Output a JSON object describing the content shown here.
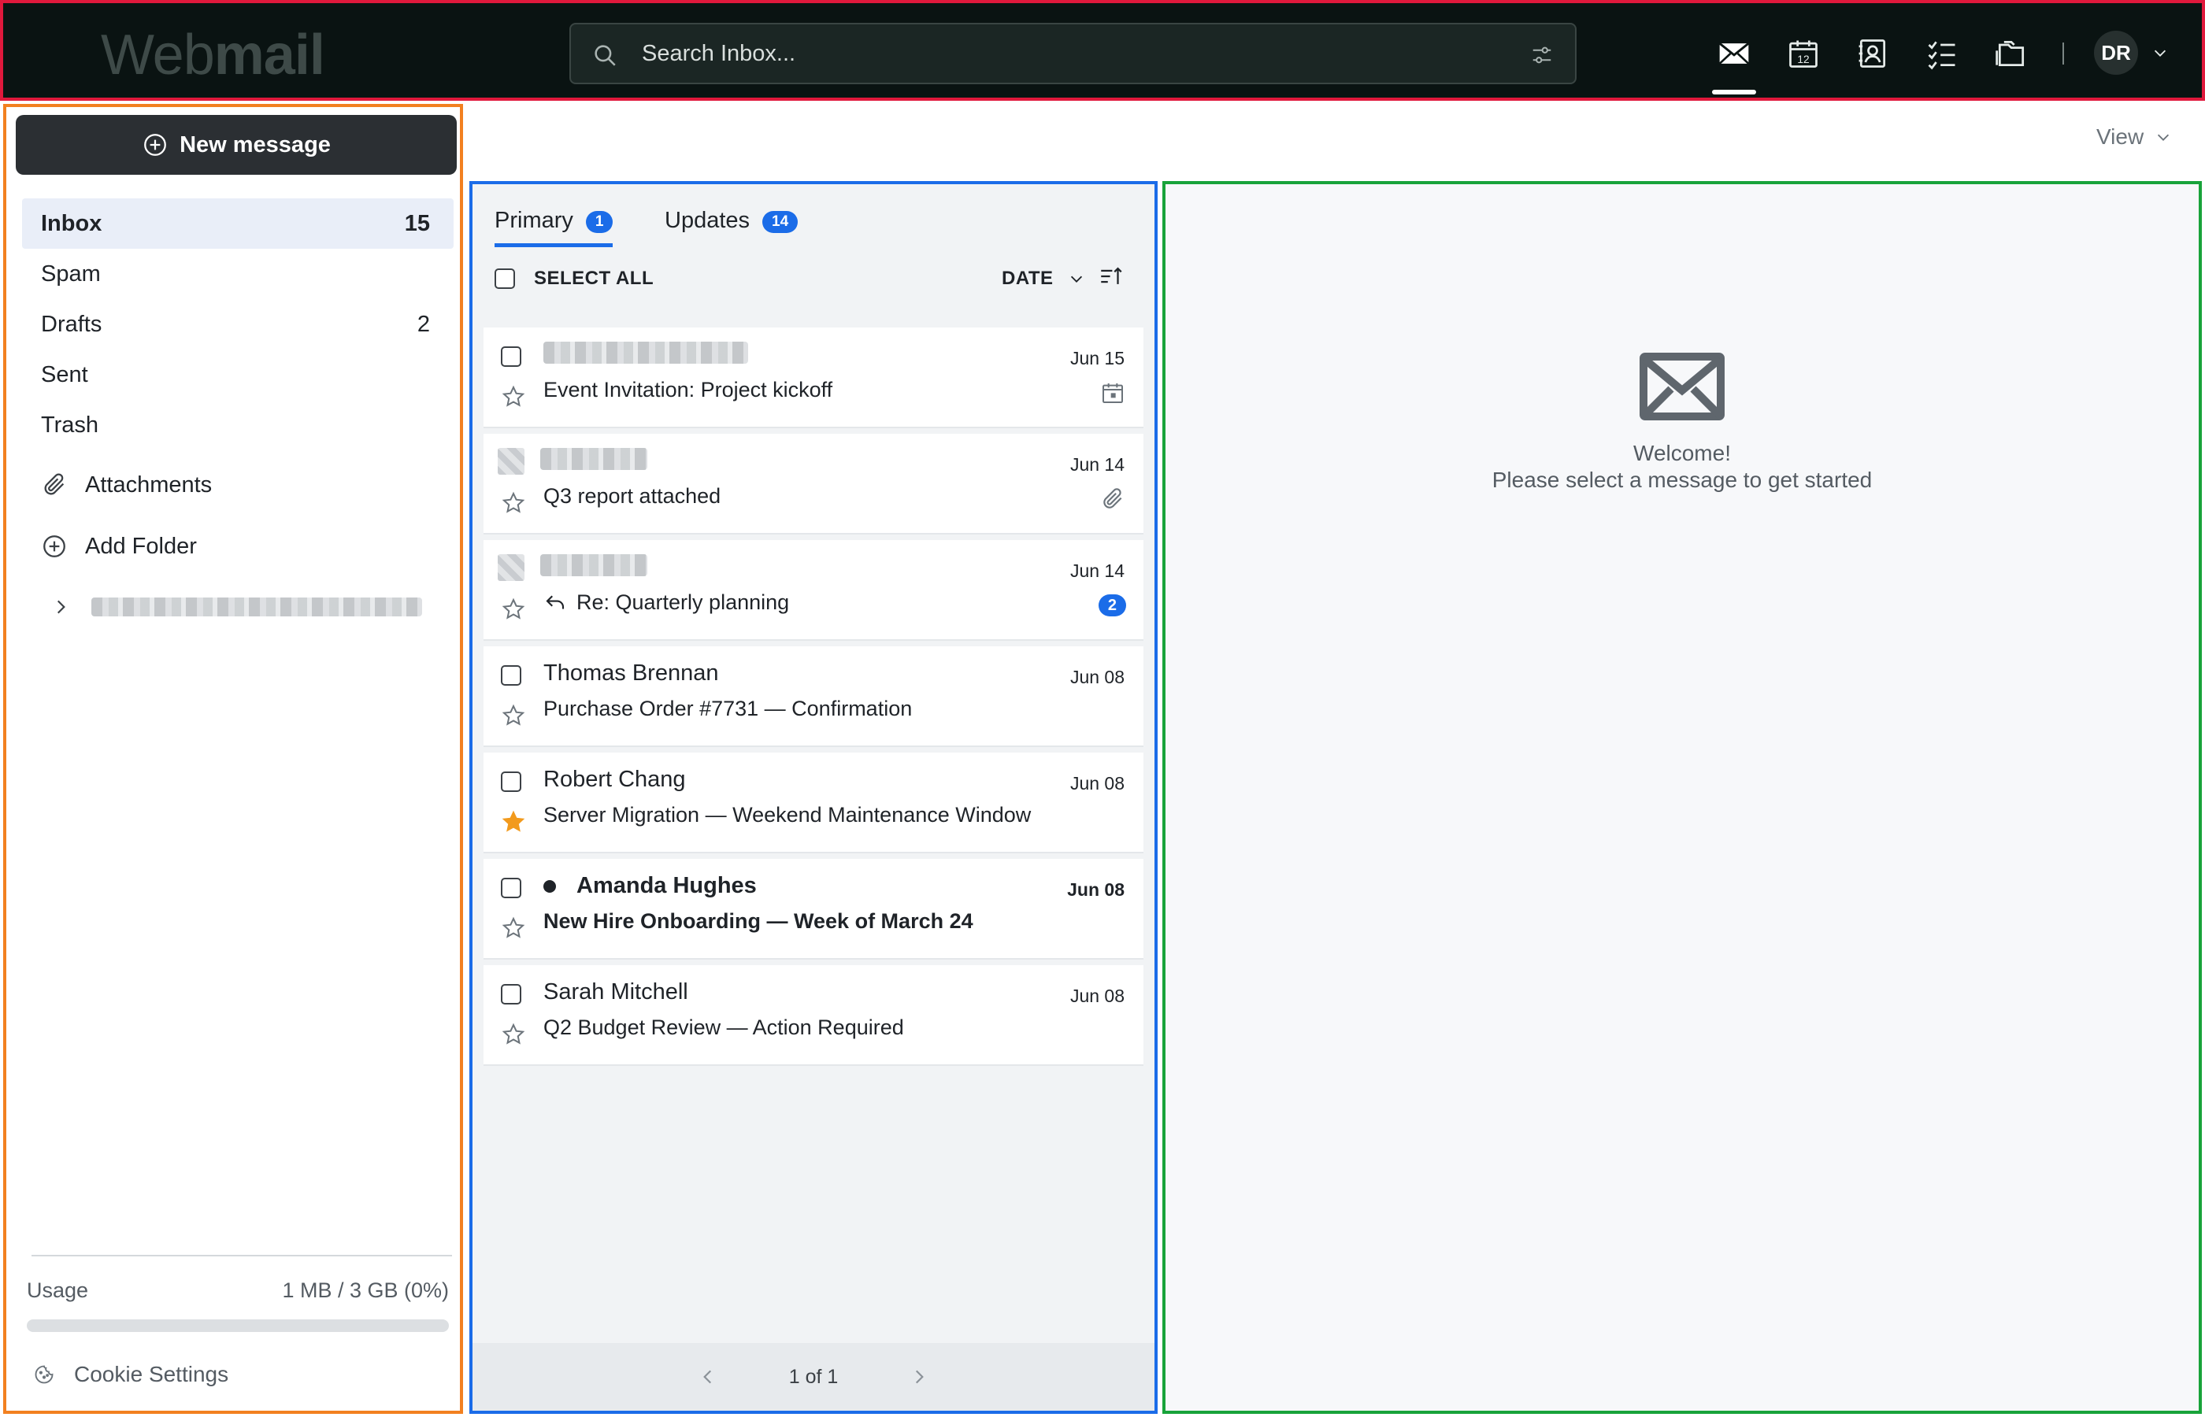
{
  "app": {
    "logo_light": "Web",
    "logo_bold": "mail"
  },
  "search": {
    "placeholder": "Search Inbox..."
  },
  "apps": [
    {
      "name": "mail-icon",
      "active": true
    },
    {
      "name": "calendar-icon",
      "active": false,
      "day": "12"
    },
    {
      "name": "contacts-icon",
      "active": false
    },
    {
      "name": "tasks-icon",
      "active": false
    },
    {
      "name": "files-icon",
      "active": false
    }
  ],
  "user": {
    "initials": "DR"
  },
  "sidebar": {
    "new_message_label": "New message",
    "folders": [
      {
        "label": "Inbox",
        "count": "15",
        "active": true
      },
      {
        "label": "Spam",
        "count": ""
      },
      {
        "label": "Drafts",
        "count": "2"
      },
      {
        "label": "Sent",
        "count": ""
      },
      {
        "label": "Trash",
        "count": ""
      }
    ],
    "attachments_label": "Attachments",
    "add_folder_label": "Add Folder",
    "usage_label": "Usage",
    "usage_value": "1 MB / 3 GB (0%)",
    "usage_percent": 0,
    "cookie_label": "Cookie Settings"
  },
  "view": {
    "label": "View"
  },
  "list": {
    "tabs": [
      {
        "label": "Primary",
        "badge": "1",
        "active": true
      },
      {
        "label": "Updates",
        "badge": "14",
        "active": false
      }
    ],
    "select_all_label": "SELECT ALL",
    "sort_label": "DATE",
    "messages": [
      {
        "sender": "",
        "sender_redacted": true,
        "subject": "Event Invitation: Project kickoff",
        "date": "Jun 15",
        "meta": "calendar-icon",
        "starred": false,
        "unread": false,
        "replied": false
      },
      {
        "sender": "",
        "sender_redacted": true,
        "subject": "Q3 report attached",
        "date": "Jun 14",
        "meta": "paperclip-icon",
        "starred": false,
        "unread": false,
        "replied": false
      },
      {
        "sender": "",
        "sender_redacted": true,
        "subject": "Re: Quarterly planning",
        "date": "Jun 14",
        "meta": "thread-count",
        "thread_count": "2",
        "starred": false,
        "unread": false,
        "replied": true
      },
      {
        "sender": "Thomas Brennan",
        "subject": "Purchase Order #7731 — Confirmation",
        "date": "Jun 08",
        "starred": false,
        "unread": false,
        "replied": false
      },
      {
        "sender": "Robert Chang",
        "subject": "Server Migration — Weekend Maintenance Window",
        "date": "Jun 08",
        "starred": true,
        "unread": false,
        "replied": false
      },
      {
        "sender": "Amanda Hughes",
        "subject": "New Hire Onboarding — Week of March 24",
        "date": "Jun 08",
        "starred": false,
        "unread": true,
        "replied": false
      },
      {
        "sender": "Sarah Mitchell",
        "subject": "Q2 Budget Review — Action Required",
        "date": "Jun 08",
        "starred": false,
        "unread": false,
        "replied": false
      }
    ],
    "pagination": "1 of 1"
  },
  "reader": {
    "welcome_title": "Welcome!",
    "welcome_subtitle": "Please select a message to get started"
  },
  "colors": {
    "accent": "#1b6ce8",
    "star": "#f29a1d",
    "topbar": "#0a1312"
  }
}
